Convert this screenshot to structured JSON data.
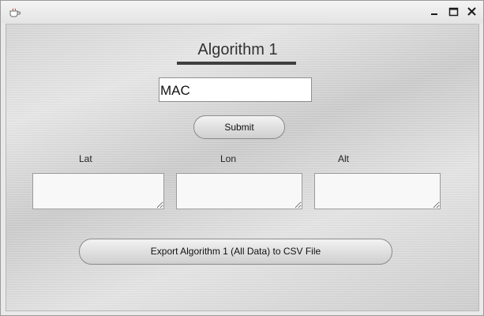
{
  "window": {
    "title": "",
    "controls": {
      "minimize_icon": "minimize-icon",
      "maximize_icon": "maximize-icon",
      "close_icon": "close-icon"
    }
  },
  "header": {
    "title": "Algorithm 1"
  },
  "mac_input": {
    "value": "MAC"
  },
  "submit_button": {
    "label": "Submit"
  },
  "coordinates": {
    "lat_label": "Lat",
    "lon_label": "Lon",
    "alt_label": "Alt",
    "lat_value": "",
    "lon_value": "",
    "alt_value": ""
  },
  "export_button": {
    "label": "Export Algorithm 1 (All Data) to CSV File"
  },
  "colors": {
    "background": "#d8d8d8",
    "title_underline": "#3f3f3f",
    "text": "#333333"
  }
}
